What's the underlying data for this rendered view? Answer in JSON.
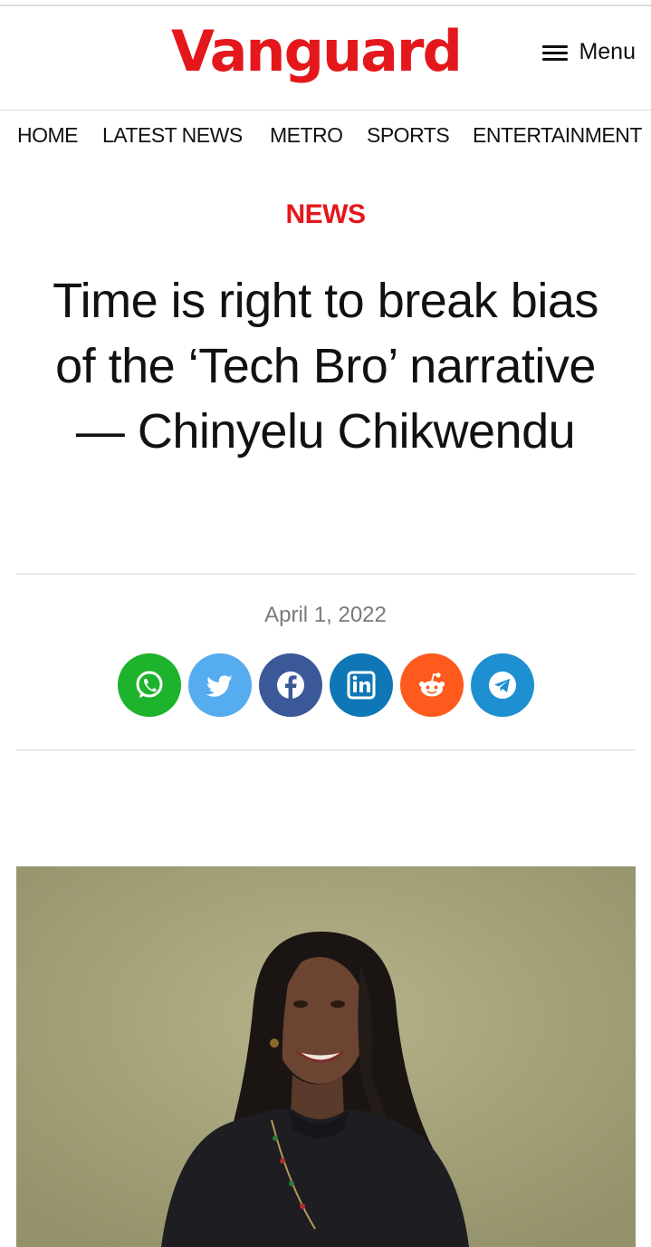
{
  "header": {
    "logo": "Vanguard",
    "menu_label": "Menu"
  },
  "nav": {
    "items": [
      "HOME",
      "LATEST NEWS",
      "METRO",
      "SPORTS",
      "ENTERTAINMENT"
    ]
  },
  "article": {
    "category": "NEWS",
    "title": "Time is right to break bias of the ‘Tech Bro’ narrative — Chinyelu Chikwendu",
    "date": "April 1, 2022"
  },
  "share": [
    {
      "icon": "whatsapp-icon",
      "color": "#1db32c"
    },
    {
      "icon": "twitter-icon",
      "color": "#55acee"
    },
    {
      "icon": "facebook-icon",
      "color": "#3b5998"
    },
    {
      "icon": "linkedin-icon",
      "color": "#0f77b5"
    },
    {
      "icon": "reddit-icon",
      "color": "#ff5a1e"
    },
    {
      "icon": "telegram-icon",
      "color": "#1e8fd0"
    }
  ],
  "colors": {
    "brand_red": "#e4171c",
    "date_gray": "#7a7a7a"
  }
}
